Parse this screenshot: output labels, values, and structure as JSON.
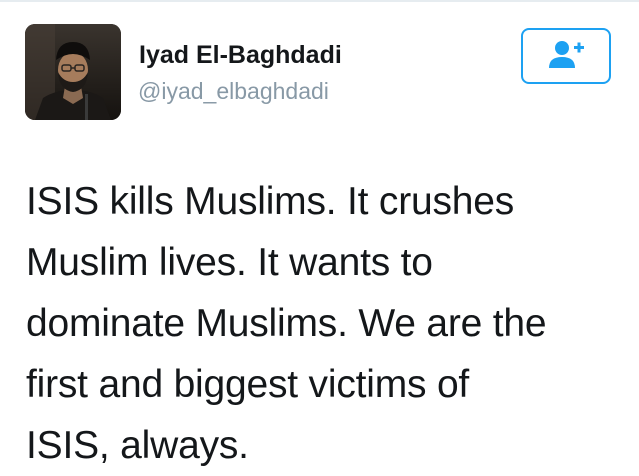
{
  "author": {
    "name": "Iyad El-Baghdadi",
    "handle": "@iyad_elbaghdadi"
  },
  "follow_button": {
    "icon": "add-user-icon"
  },
  "tweet": {
    "lines": [
      "ISIS kills Muslims. It crushes",
      "Muslim lives. It wants to",
      "dominate Muslims. We are the",
      "first and biggest victims of",
      "ISIS, always."
    ]
  },
  "colors": {
    "accent": "#1da1f2",
    "handle": "#8899a6",
    "text": "#14171a"
  }
}
